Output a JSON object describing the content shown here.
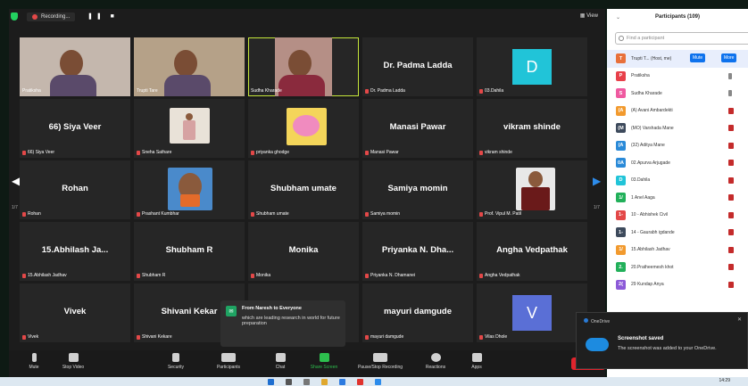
{
  "topbar": {
    "recording_label": "Recording...",
    "view_label": "View"
  },
  "grid_pagination": {
    "left": "1/7",
    "right": "1/7"
  },
  "tiles": [
    {
      "big": "",
      "label": "Pratiksha",
      "muted": false,
      "video": "woman-1"
    },
    {
      "big": "",
      "label": "Trupti Tare",
      "muted": false,
      "video": "woman-2"
    },
    {
      "big": "",
      "label": "Sudha Kharade",
      "muted": false,
      "video": "woman-3",
      "active": true
    },
    {
      "big": "Dr. Padma Ladda",
      "label": "Dr. Padma Ladda",
      "muted": true
    },
    {
      "big": "",
      "label": "03.Dahila",
      "muted": true,
      "avatar": {
        "letter": "D",
        "color": "#21c4d8"
      }
    },
    {
      "big": "66) Siya Veer",
      "label": "66) Siya Veer",
      "muted": true
    },
    {
      "big": "",
      "label": "Sneha Sathare",
      "muted": true,
      "video": "dancer"
    },
    {
      "big": "",
      "label": "priyanka ghodge",
      "muted": true,
      "video": "pink"
    },
    {
      "big": "Manasi Pawar",
      "label": "Manasi Pawar",
      "muted": true
    },
    {
      "big": "vikram shinde",
      "label": "vikram shinde",
      "muted": true
    },
    {
      "big": "Rohan",
      "label": "Rohan",
      "muted": true
    },
    {
      "big": "",
      "label": "Prashant Kumbhar",
      "muted": true,
      "video": "man-photo"
    },
    {
      "big": "Shubham umate",
      "label": "Shubham umate",
      "muted": true
    },
    {
      "big": "Samiya momin",
      "label": "Samiya momin",
      "muted": true
    },
    {
      "big": "",
      "label": "Prof. Vipul M. Patil",
      "muted": true,
      "video": "man-suit"
    },
    {
      "big": "15.Abhilash Ja...",
      "label": "15.Abhilash Jadhav",
      "muted": true
    },
    {
      "big": "Shubham R",
      "label": "Shubham R",
      "muted": true
    },
    {
      "big": "Monika",
      "label": "Monika",
      "muted": true
    },
    {
      "big": "Priyanka N. Dha...",
      "label": "Priyanka N. Dhamanei",
      "muted": true
    },
    {
      "big": "Angha Vedpathak",
      "label": "Angha Vedpathak",
      "muted": true
    },
    {
      "big": "Vivek",
      "label": "Vivek",
      "muted": true
    },
    {
      "big": "Shivani Kekar",
      "label": "Shivani Kekare",
      "muted": true
    },
    {
      "big": "",
      "label": "",
      "muted": false
    },
    {
      "big": "mayuri damgude",
      "label": "mayuri damgude",
      "muted": true
    },
    {
      "big": "",
      "label": "Vilas Dhole",
      "muted": true,
      "avatar": {
        "letter": "V",
        "color": "#5a6fd6"
      }
    }
  ],
  "chat_toast": {
    "from": "From Naresh to Everyone",
    "message": "which are leading research in world for future preparation",
    "icon": "chat-icon"
  },
  "toolbar": {
    "items": [
      {
        "label": "Mute",
        "icon": "mic-icon"
      },
      {
        "label": "Stop Video",
        "icon": "video-icon"
      },
      {
        "label": "Security",
        "icon": "shield-icon"
      },
      {
        "label": "Participants",
        "icon": "participants-icon",
        "count": "118"
      },
      {
        "label": "Chat",
        "icon": "chat-icon"
      },
      {
        "label": "Share Screen",
        "icon": "share-screen-icon"
      },
      {
        "label": "Pause/Stop Recording",
        "icon": "recording-icon"
      },
      {
        "label": "Reactions",
        "icon": "reactions-icon"
      },
      {
        "label": "Apps",
        "icon": "apps-icon"
      }
    ]
  },
  "participants_panel": {
    "title": "Participants (109)",
    "search_placeholder": "Find a participant",
    "host_buttons": {
      "mute": "Mute",
      "more": "More"
    },
    "rows": [
      {
        "initial": "T",
        "color": "#e8703a",
        "name": "Trupti T... (Host, me)",
        "first": true
      },
      {
        "initial": "P",
        "color": "#e8404a",
        "name": "Pratiksha",
        "icon": "gray"
      },
      {
        "initial": "S",
        "color": "#ef5aa0",
        "name": "Sudha Kharade",
        "icon": "gray"
      },
      {
        "initial": "(A",
        "color": "#f29a2e",
        "name": "(A) Avani Ambardekti"
      },
      {
        "initial": "(M",
        "color": "#3d4a5c",
        "name": "(MO) Varshada Mane"
      },
      {
        "initial": "(A",
        "color": "#2a8ad8",
        "name": "(32) Aditya Mane"
      },
      {
        "initial": "0A",
        "color": "#2a8ad8",
        "name": "02.Apurva Arjugade"
      },
      {
        "initial": "D",
        "color": "#21c4d8",
        "name": "03.Dahila"
      },
      {
        "initial": "1/",
        "color": "#22b05a",
        "name": "1 Anel Aaga"
      },
      {
        "initial": "1-",
        "color": "#e34848",
        "name": "10 - Abhishek Civil"
      },
      {
        "initial": "1-",
        "color": "#3d4a5c",
        "name": "14 - Gaurabh igdande"
      },
      {
        "initial": "1/",
        "color": "#f29a2e",
        "name": "15.Abhilash Jadhav"
      },
      {
        "initial": "2.",
        "color": "#22b05a",
        "name": "20.Pratheemesh khot"
      },
      {
        "initial": "2(",
        "color": "#8c5ad8",
        "name": "29 Kundap Anya"
      }
    ]
  },
  "onedrive_toast": {
    "app": "OneDrive",
    "title": "Screenshot saved",
    "message": "The screenshot was added to your OneDrive."
  },
  "clock": "14:29"
}
